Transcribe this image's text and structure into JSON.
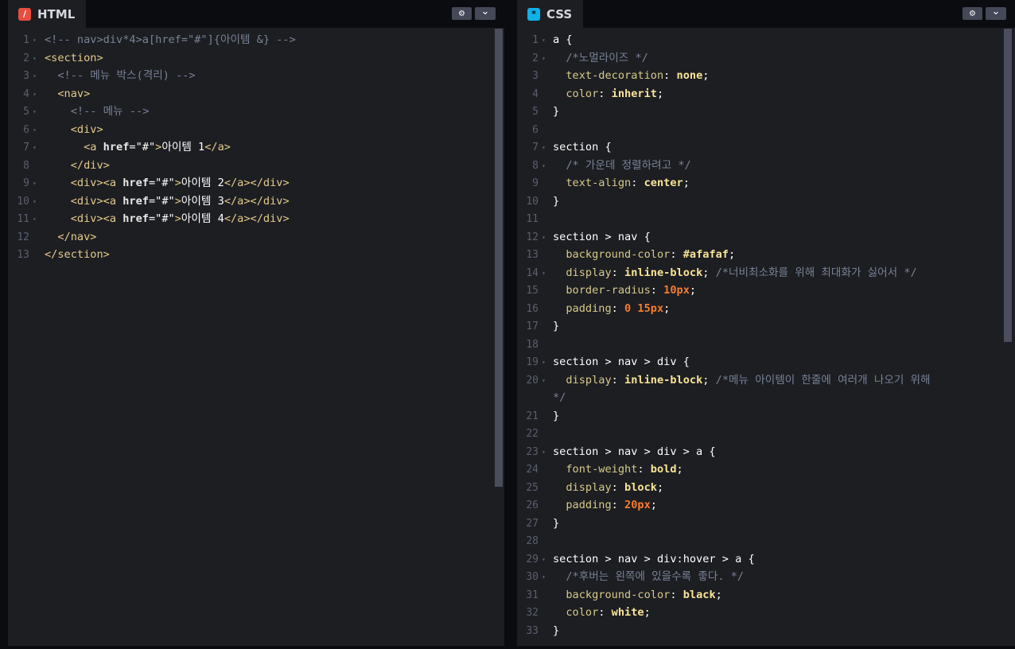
{
  "html_panel": {
    "title": "HTML",
    "icon": "html-slash-icon",
    "accent": "#e84e40",
    "lines": [
      {
        "n": "1",
        "fold": "▾",
        "parts": [
          [
            "cm",
            "<!-- nav>div*4>a[href=\"#\"]{아이템 &} -->"
          ]
        ]
      },
      {
        "n": "2",
        "fold": "▾",
        "parts": [
          [
            "tg",
            "<section>"
          ]
        ]
      },
      {
        "n": "3",
        "fold": "▾",
        "parts": [
          [
            "tx",
            "  "
          ],
          [
            "cm",
            "<!-- 메뉴 박스(격리) -->"
          ]
        ]
      },
      {
        "n": "4",
        "fold": "▾",
        "parts": [
          [
            "tx",
            "  "
          ],
          [
            "tg",
            "<nav>"
          ]
        ]
      },
      {
        "n": "5",
        "fold": "▾",
        "parts": [
          [
            "tx",
            "    "
          ],
          [
            "cm",
            "<!-- 메뉴 -->"
          ]
        ]
      },
      {
        "n": "6",
        "fold": "▾",
        "parts": [
          [
            "tx",
            "    "
          ],
          [
            "tg",
            "<div>"
          ]
        ]
      },
      {
        "n": "7",
        "fold": "▾",
        "parts": [
          [
            "tx",
            "      "
          ],
          [
            "tg",
            "<a "
          ],
          [
            "at",
            "href"
          ],
          [
            "pun",
            "="
          ],
          [
            "tx",
            "\"#\""
          ],
          [
            "tg",
            ">"
          ],
          [
            "tx",
            "아이템 1"
          ],
          [
            "tg",
            "</a>"
          ]
        ]
      },
      {
        "n": "8",
        "fold": "",
        "parts": [
          [
            "tx",
            "    "
          ],
          [
            "tg",
            "</div>"
          ]
        ]
      },
      {
        "n": "9",
        "fold": "▾",
        "parts": [
          [
            "tx",
            "    "
          ],
          [
            "tg",
            "<div><a "
          ],
          [
            "at",
            "href"
          ],
          [
            "pun",
            "="
          ],
          [
            "tx",
            "\"#\""
          ],
          [
            "tg",
            ">"
          ],
          [
            "tx",
            "아이템 2"
          ],
          [
            "tg",
            "</a></div>"
          ]
        ]
      },
      {
        "n": "10",
        "fold": "▾",
        "parts": [
          [
            "tx",
            "    "
          ],
          [
            "tg",
            "<div><a "
          ],
          [
            "at",
            "href"
          ],
          [
            "pun",
            "="
          ],
          [
            "tx",
            "\"#\""
          ],
          [
            "tg",
            ">"
          ],
          [
            "tx",
            "아이템 3"
          ],
          [
            "tg",
            "</a></div>"
          ]
        ]
      },
      {
        "n": "11",
        "fold": "▾",
        "parts": [
          [
            "tx",
            "    "
          ],
          [
            "tg",
            "<div><a "
          ],
          [
            "at",
            "href"
          ],
          [
            "pun",
            "="
          ],
          [
            "tx",
            "\"#\""
          ],
          [
            "tg",
            ">"
          ],
          [
            "tx",
            "아이템 4"
          ],
          [
            "tg",
            "</a></div>"
          ]
        ]
      },
      {
        "n": "12",
        "fold": "",
        "parts": [
          [
            "tx",
            "  "
          ],
          [
            "tg",
            "</nav>"
          ]
        ]
      },
      {
        "n": "13",
        "fold": "",
        "parts": [
          [
            "tg",
            "</section>"
          ]
        ]
      }
    ]
  },
  "css_panel": {
    "title": "CSS",
    "icon": "css-asterisk-icon",
    "accent": "#0fb1e6",
    "lines": [
      {
        "n": "1",
        "fold": "▾",
        "parts": [
          [
            "sel",
            "a "
          ],
          [
            "pun",
            "{"
          ]
        ]
      },
      {
        "n": "2",
        "fold": "▾",
        "parts": [
          [
            "tx",
            "  "
          ],
          [
            "cm",
            "/*노멀라이즈 */"
          ]
        ]
      },
      {
        "n": "3",
        "fold": "",
        "parts": [
          [
            "tx",
            "  "
          ],
          [
            "pr",
            "text-decoration"
          ],
          [
            "pun",
            ": "
          ],
          [
            "vl",
            "none"
          ],
          [
            "pun",
            ";"
          ]
        ]
      },
      {
        "n": "4",
        "fold": "",
        "parts": [
          [
            "tx",
            "  "
          ],
          [
            "pr",
            "color"
          ],
          [
            "pun",
            ": "
          ],
          [
            "vl",
            "inherit"
          ],
          [
            "pun",
            ";"
          ]
        ]
      },
      {
        "n": "5",
        "fold": "",
        "parts": [
          [
            "pun",
            "}"
          ]
        ]
      },
      {
        "n": "6",
        "fold": "",
        "parts": []
      },
      {
        "n": "7",
        "fold": "▾",
        "parts": [
          [
            "sel",
            "section "
          ],
          [
            "pun",
            "{"
          ]
        ]
      },
      {
        "n": "8",
        "fold": "▾",
        "parts": [
          [
            "tx",
            "  "
          ],
          [
            "cm",
            "/* 가운데 정렬하려고 */"
          ]
        ]
      },
      {
        "n": "9",
        "fold": "",
        "parts": [
          [
            "tx",
            "  "
          ],
          [
            "pr",
            "text-align"
          ],
          [
            "pun",
            ": "
          ],
          [
            "vl",
            "center"
          ],
          [
            "pun",
            ";"
          ]
        ]
      },
      {
        "n": "10",
        "fold": "",
        "parts": [
          [
            "pun",
            "}"
          ]
        ]
      },
      {
        "n": "11",
        "fold": "",
        "parts": []
      },
      {
        "n": "12",
        "fold": "▾",
        "parts": [
          [
            "sel",
            "section > nav "
          ],
          [
            "pun",
            "{"
          ]
        ]
      },
      {
        "n": "13",
        "fold": "",
        "parts": [
          [
            "tx",
            "  "
          ],
          [
            "pr",
            "background-color"
          ],
          [
            "pun",
            ": "
          ],
          [
            "vl",
            "#afafaf"
          ],
          [
            "pun",
            ";"
          ]
        ]
      },
      {
        "n": "14",
        "fold": "▾",
        "parts": [
          [
            "tx",
            "  "
          ],
          [
            "pr",
            "display"
          ],
          [
            "pun",
            ": "
          ],
          [
            "vl",
            "inline-block"
          ],
          [
            "pun",
            "; "
          ],
          [
            "cm",
            "/*너비최소화를 위해 최대화가 싫어서 */"
          ]
        ]
      },
      {
        "n": "15",
        "fold": "",
        "parts": [
          [
            "tx",
            "  "
          ],
          [
            "pr",
            "border-radius"
          ],
          [
            "pun",
            ": "
          ],
          [
            "nm",
            "10px"
          ],
          [
            "pun",
            ";"
          ]
        ]
      },
      {
        "n": "16",
        "fold": "",
        "parts": [
          [
            "tx",
            "  "
          ],
          [
            "pr",
            "padding"
          ],
          [
            "pun",
            ": "
          ],
          [
            "nm",
            "0 15px"
          ],
          [
            "pun",
            ";"
          ]
        ]
      },
      {
        "n": "17",
        "fold": "",
        "parts": [
          [
            "pun",
            "}"
          ]
        ]
      },
      {
        "n": "18",
        "fold": "",
        "parts": []
      },
      {
        "n": "19",
        "fold": "▾",
        "parts": [
          [
            "sel",
            "section > nav > div "
          ],
          [
            "pun",
            "{"
          ]
        ]
      },
      {
        "n": "20",
        "fold": "▾",
        "parts": [
          [
            "tx",
            "  "
          ],
          [
            "pr",
            "display"
          ],
          [
            "pun",
            ": "
          ],
          [
            "vl",
            "inline-block"
          ],
          [
            "pun",
            "; "
          ],
          [
            "cm",
            "/*메뉴 아이템이 한줄에 여러개 나오기 위해"
          ]
        ]
      },
      {
        "n": "",
        "fold": "",
        "parts": [
          [
            "cm",
            "*/"
          ]
        ]
      },
      {
        "n": "21",
        "fold": "",
        "parts": [
          [
            "pun",
            "}"
          ]
        ]
      },
      {
        "n": "22",
        "fold": "",
        "parts": []
      },
      {
        "n": "23",
        "fold": "▾",
        "parts": [
          [
            "sel",
            "section > nav > div > a "
          ],
          [
            "pun",
            "{"
          ]
        ]
      },
      {
        "n": "24",
        "fold": "",
        "parts": [
          [
            "tx",
            "  "
          ],
          [
            "pr",
            "font-weight"
          ],
          [
            "pun",
            ": "
          ],
          [
            "vl",
            "bold"
          ],
          [
            "pun",
            ";"
          ]
        ]
      },
      {
        "n": "25",
        "fold": "",
        "parts": [
          [
            "tx",
            "  "
          ],
          [
            "pr",
            "display"
          ],
          [
            "pun",
            ": "
          ],
          [
            "vl",
            "block"
          ],
          [
            "pun",
            ";"
          ]
        ]
      },
      {
        "n": "26",
        "fold": "",
        "parts": [
          [
            "tx",
            "  "
          ],
          [
            "pr",
            "padding"
          ],
          [
            "pun",
            ": "
          ],
          [
            "nm",
            "20px"
          ],
          [
            "pun",
            ";"
          ]
        ]
      },
      {
        "n": "27",
        "fold": "",
        "parts": [
          [
            "pun",
            "}"
          ]
        ]
      },
      {
        "n": "28",
        "fold": "",
        "parts": []
      },
      {
        "n": "29",
        "fold": "▾",
        "parts": [
          [
            "sel",
            "section > nav > div"
          ],
          [
            "pun",
            ":"
          ],
          [
            "sel",
            "hover > a "
          ],
          [
            "pun",
            "{"
          ]
        ]
      },
      {
        "n": "30",
        "fold": "▾",
        "parts": [
          [
            "tx",
            "  "
          ],
          [
            "cm",
            "/*후버는 왼쪽에 있을수록 좋다. */"
          ]
        ]
      },
      {
        "n": "31",
        "fold": "",
        "parts": [
          [
            "tx",
            "  "
          ],
          [
            "pr",
            "background-color"
          ],
          [
            "pun",
            ": "
          ],
          [
            "vl",
            "black"
          ],
          [
            "pun",
            ";"
          ]
        ]
      },
      {
        "n": "32",
        "fold": "",
        "parts": [
          [
            "tx",
            "  "
          ],
          [
            "pr",
            "color"
          ],
          [
            "pun",
            ": "
          ],
          [
            "vl",
            "white"
          ],
          [
            "pun",
            ";"
          ]
        ]
      },
      {
        "n": "33",
        "fold": "",
        "parts": [
          [
            "pun",
            "}"
          ]
        ]
      }
    ]
  },
  "buttons": {
    "settings": "⚙",
    "collapse": "⌄",
    "settings_icon": "gear-icon",
    "collapse_icon": "chevron-down-icon"
  },
  "tab_glyphs": {
    "html": "/",
    "css": "*"
  }
}
